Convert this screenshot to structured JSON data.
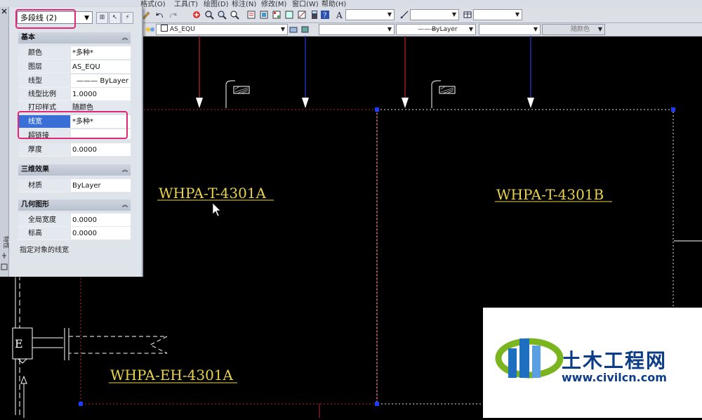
{
  "menu": {
    "items": [
      "格式(O)",
      "工具(T)",
      "绘图(D)",
      "标注(N)",
      "修改(M)",
      "窗口(W)",
      "帮助(H)"
    ]
  },
  "toolbar": {
    "layer_name": "AS_EQU",
    "linetype": "ByLayer",
    "color": "随颜色"
  },
  "palette": {
    "selection": "多段线 (2)",
    "sections": {
      "general": "基本",
      "3d": "三维效果",
      "geometry": "几何图形"
    },
    "general_rows": [
      {
        "key": "颜色",
        "value": "*多种*"
      },
      {
        "key": "图层",
        "value": "AS_EQU"
      },
      {
        "key": "线型",
        "value": "——— ByLayer"
      },
      {
        "key": "线型比例",
        "value": "1.0000"
      },
      {
        "key": "打印样式",
        "value": "随颜色"
      },
      {
        "key": "线宽",
        "value": "*多种*"
      },
      {
        "key": "超链接",
        "value": ""
      },
      {
        "key": "厚度",
        "value": "0.0000"
      }
    ],
    "3d_rows": [
      {
        "key": "材质",
        "value": "ByLayer"
      }
    ],
    "geometry_rows": [
      {
        "key": "全局宽度",
        "value": "0.0000"
      },
      {
        "key": "标高",
        "value": "0.0000"
      }
    ],
    "description": "指定对象的线宽"
  },
  "drawing": {
    "label_a": "WHPA-T-4301A",
    "label_b": "WHPA-T-4301B",
    "label_eh": "WHPA-EH-4301A",
    "box_letter": "E"
  },
  "watermark": {
    "name": "土木工程网",
    "url": "www.civilcn.com"
  },
  "colors": {
    "highlight": "#e0287a",
    "label": "#e9d34a",
    "red_line": "#c0262b",
    "blue_line": "#2a3dd6"
  }
}
